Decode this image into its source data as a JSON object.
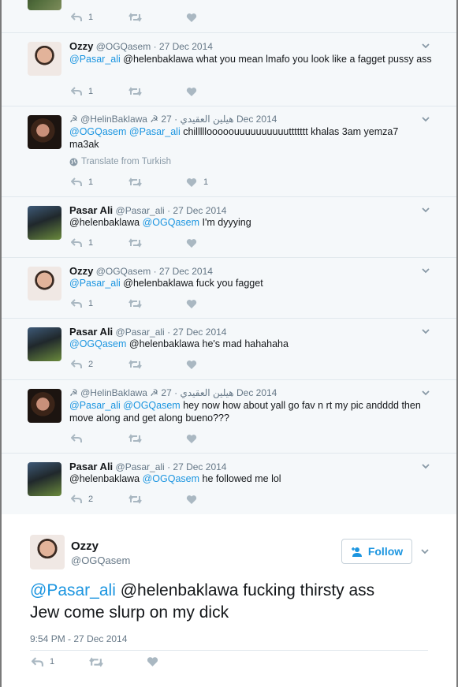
{
  "thread": [
    {
      "name": "",
      "handle": "",
      "date": "",
      "text": [],
      "reply_count": "1",
      "fav_count": "",
      "translate": ""
    },
    {
      "name": "Ozzy",
      "handle": "@OGQasem",
      "date": "· 27 Dec 2014",
      "text_line1_mention": "@Pasar_ali",
      "text_line1_rest": " @helenbaklawa what you mean lmafo you look like a fagget pussy ass",
      "reply_count": "1",
      "fav_count": ""
    },
    {
      "name": "☭ @HelinBaklawa ☭ هيلين العقيدي",
      "handle": "",
      "date": "· 27 Dec 2014",
      "mention1": "@OGQasem",
      "mention2": "@Pasar_ali",
      "text_rest": " chilllllooooouuuuuuuuuuttttttt khalas 3am yemza7 ma3ak",
      "translate": "Translate from Turkish",
      "reply_count": "1",
      "fav_count": "1"
    },
    {
      "name": "Pasar Ali",
      "handle": "@Pasar_ali",
      "date": "· 27 Dec 2014",
      "text_pre": "@helenbaklawa ",
      "mention": "@OGQasem",
      "text_post": " I'm dyyying",
      "reply_count": "1",
      "fav_count": ""
    },
    {
      "name": "Ozzy",
      "handle": "@OGQasem",
      "date": "· 27 Dec 2014",
      "mention": "@Pasar_ali",
      "text_post": " @helenbaklawa fuck you fagget",
      "reply_count": "1",
      "fav_count": ""
    },
    {
      "name": "Pasar Ali",
      "handle": "@Pasar_ali",
      "date": "· 27 Dec 2014",
      "mention": "@OGQasem",
      "text_post": " @helenbaklawa he's mad hahahaha",
      "reply_count": "2",
      "fav_count": ""
    },
    {
      "name": "☭ @HelinBaklawa ☭ هيلين العقيدي",
      "handle": "",
      "date": "· 27 Dec 2014",
      "mention1": "@Pasar_ali",
      "mention2": "@OGQasem",
      "text_line1": " hey now how about yall go fav n rt my pic andddd then",
      "text_line2": "move along and get along bueno???",
      "reply_count": "",
      "fav_count": ""
    },
    {
      "name": "Pasar Ali",
      "handle": "@Pasar_ali",
      "date": "· 27 Dec 2014",
      "text_pre": "@helenbaklawa ",
      "mention": "@OGQasem",
      "text_post": " he followed me lol",
      "reply_count": "2",
      "fav_count": ""
    }
  ],
  "main_tweet": {
    "name": "Ozzy",
    "handle": "@OGQasem",
    "follow_label": "Follow",
    "mention": "@Pasar_ali",
    "text_line1_rest": " @helenbaklawa fucking thirsty ass",
    "text_line2": "Jew come slurp on my dick",
    "timestamp": "9:54 PM - 27 Dec 2014",
    "reply_count": "1"
  },
  "colors": {
    "link": "#1b95e0",
    "muted": "#657786",
    "icon": "#aab8c2",
    "thread_bg": "#f5f8fa"
  },
  "icons": [
    "reply-icon",
    "retweet-icon",
    "like-icon",
    "chevron-down-icon",
    "globe-icon",
    "follow-person-icon"
  ]
}
